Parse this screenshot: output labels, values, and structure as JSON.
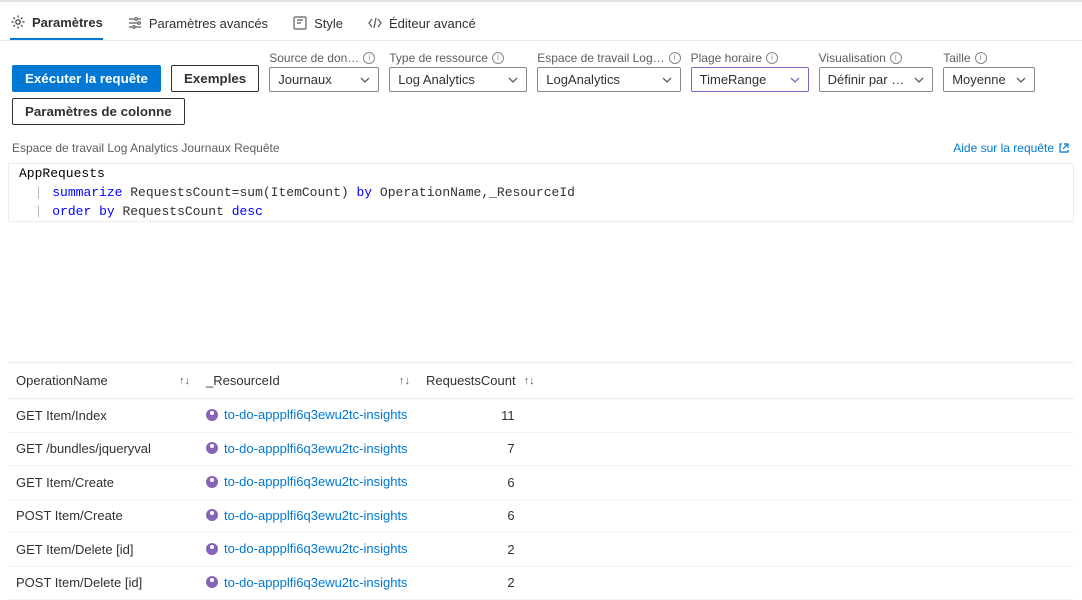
{
  "tabs": {
    "settings": "Paramètres",
    "advanced_settings": "Paramètres avancés",
    "style": "Style",
    "advanced_editor": "Éditeur avancé"
  },
  "toolbar": {
    "run_query": "Exécuter la requête",
    "samples": "Exemples",
    "column_settings": "Paramètres de colonne",
    "datasource": {
      "label": "Source de don…",
      "value": "Journaux"
    },
    "resource_type": {
      "label": "Type de ressource",
      "value": "Log Analytics"
    },
    "workspace": {
      "label": "Espace de travail Log…",
      "value": "LogAnalytics"
    },
    "time_range": {
      "label": "Plage horaire",
      "value": "TimeRange"
    },
    "visualization": {
      "label": "Visualisation",
      "value": "Définir par …"
    },
    "size": {
      "label": "Taille",
      "value": "Moyenne"
    }
  },
  "breadcrumb": "Espace de travail Log Analytics Journaux Requête",
  "help_link": "Aide sur la requête",
  "query": {
    "line1": "AppRequests",
    "l2_kw": "summarize",
    "l2_rest": " RequestsCount=sum(ItemCount) ",
    "l2_by": "by",
    "l2_cols": " OperationName,_ResourceId",
    "l3_order": "order",
    "l3_by": "by",
    "l3_rest": " RequestsCount ",
    "l3_desc": "desc"
  },
  "columns": {
    "operation": "OperationName",
    "resource": "_ResourceId",
    "count": "RequestsCount"
  },
  "rows": [
    {
      "op": "GET Item/Index",
      "res": "to-do-appplfi6q3ewu2tc-insights",
      "count": "11"
    },
    {
      "op": "GET /bundles/jqueryval",
      "res": "to-do-appplfi6q3ewu2tc-insights",
      "count": "7"
    },
    {
      "op": "GET Item/Create",
      "res": "to-do-appplfi6q3ewu2tc-insights",
      "count": "6"
    },
    {
      "op": "POST Item/Create",
      "res": "to-do-appplfi6q3ewu2tc-insights",
      "count": "6"
    },
    {
      "op": "GET Item/Delete [id]",
      "res": "to-do-appplfi6q3ewu2tc-insights",
      "count": "2"
    },
    {
      "op": "POST Item/Delete [id]",
      "res": "to-do-appplfi6q3ewu2tc-insights",
      "count": "2"
    }
  ]
}
